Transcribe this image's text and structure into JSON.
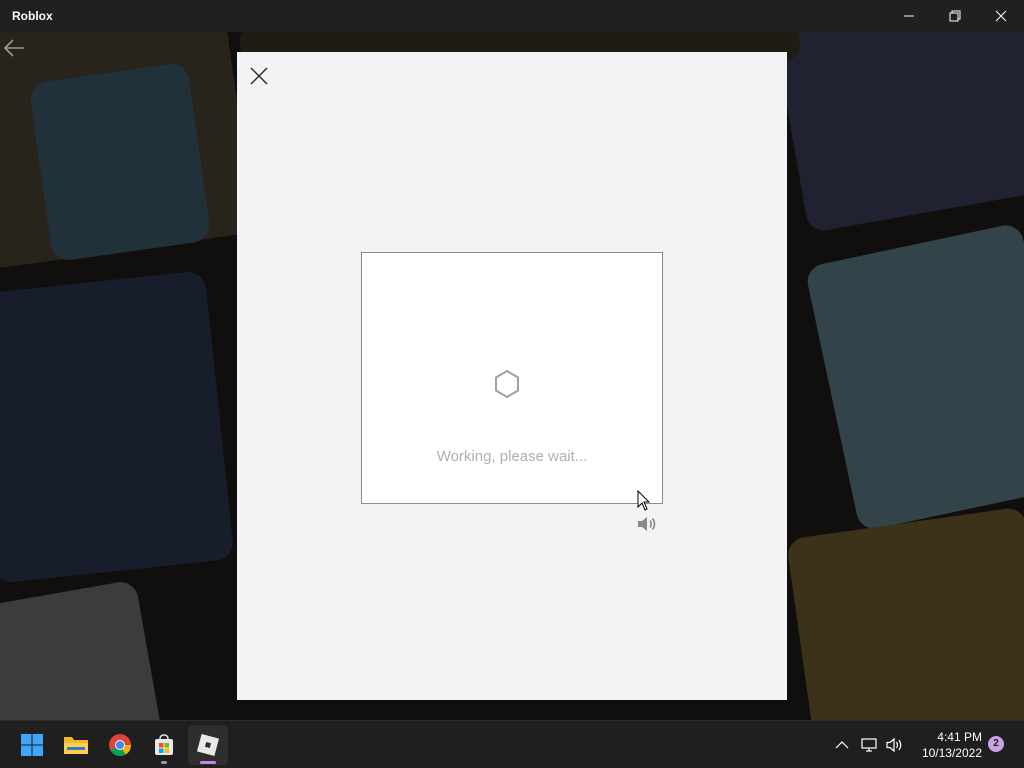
{
  "window": {
    "title": "Roblox",
    "controls": [
      "minimize-icon",
      "restore-icon",
      "close-icon"
    ]
  },
  "modal": {
    "close_icon": "close-icon",
    "captcha": {
      "spinner_icon": "hexagon-spinner-icon",
      "status_text": "Working, please wait...",
      "audio_icon": "speaker-icon"
    }
  },
  "taskbar": {
    "apps": [
      {
        "name": "start-button",
        "icon": "windows-logo-icon"
      },
      {
        "name": "file-explorer-button",
        "icon": "folder-icon"
      },
      {
        "name": "chrome-button",
        "icon": "chrome-icon"
      },
      {
        "name": "microsoft-store-button",
        "icon": "store-icon"
      },
      {
        "name": "roblox-taskbar-button",
        "icon": "roblox-icon",
        "active": true
      }
    ],
    "tray": {
      "icons": [
        "chevron-up-icon",
        "network-icon",
        "volume-icon"
      ],
      "time": "4:41 PM",
      "date": "10/13/2022",
      "notification_count": "2"
    }
  },
  "colors": {
    "titlebar_bg": "#202020",
    "modal_bg": "#f2f3f4",
    "taskbar_bg": "#1f1f1f",
    "accent_indicator": "#c586e0"
  }
}
